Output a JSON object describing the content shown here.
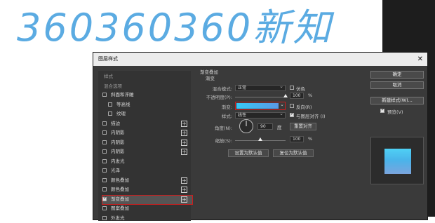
{
  "watermark": {
    "text": "360360360新知",
    "color": "#4aa3df"
  },
  "dialog": {
    "title": "图层样式",
    "close_glyph": "✕"
  },
  "left_panel": {
    "heading": "样式",
    "blend_options": "混合选项",
    "items": [
      {
        "label": "斜面和浮雕",
        "checked": false,
        "indent": false,
        "plus": false
      },
      {
        "label": "等高线",
        "checked": false,
        "indent": true,
        "plus": false
      },
      {
        "label": "纹理",
        "checked": false,
        "indent": true,
        "plus": false
      },
      {
        "label": "描边",
        "checked": false,
        "indent": false,
        "plus": true
      },
      {
        "label": "内阴影",
        "checked": false,
        "indent": false,
        "plus": true
      },
      {
        "label": "内阴影",
        "checked": false,
        "indent": false,
        "plus": true
      },
      {
        "label": "内阴影",
        "checked": false,
        "indent": false,
        "plus": true
      },
      {
        "label": "内发光",
        "checked": false,
        "indent": false,
        "plus": false
      },
      {
        "label": "光泽",
        "checked": false,
        "indent": false,
        "plus": false
      },
      {
        "label": "颜色叠加",
        "checked": false,
        "indent": false,
        "plus": true
      },
      {
        "label": "颜色叠加",
        "checked": false,
        "indent": false,
        "plus": true
      },
      {
        "label": "渐变叠加",
        "checked": true,
        "indent": false,
        "plus": true,
        "selected": true
      },
      {
        "label": "图案叠加",
        "checked": false,
        "indent": false,
        "plus": false
      },
      {
        "label": "外发光",
        "checked": false,
        "indent": false,
        "plus": false
      }
    ],
    "plus_glyph": "+"
  },
  "gradient_overlay": {
    "section_title": "渐变叠加",
    "subsection_title": "渐变",
    "blend_mode_label": "混合模式:",
    "blend_mode_value": "正常",
    "dither_label": "仿色",
    "opacity_label": "不透明度(P):",
    "opacity_value": "100",
    "opacity_fraction": 1.0,
    "percent": "%",
    "gradient_label": "渐变:",
    "reverse_label": "反向(R)",
    "style_label": "样式:",
    "style_value": "线性",
    "align_label": "与图层对齐 (I)",
    "angle_label": "角度(N):",
    "angle_value": "90",
    "degree_label": "度",
    "reset_align_button": "重置对齐",
    "scale_label": "缩放(S):",
    "scale_value": "100",
    "scale_fraction": 0.5,
    "set_default_button": "设置为默认值",
    "reset_default_button": "复位为默认值",
    "gradient_colors": [
      "#37c8f5",
      "#5a98e6"
    ],
    "dither_checked": false,
    "reverse_checked": false,
    "align_checked": true
  },
  "right_panel": {
    "ok_button": "确定",
    "cancel_button": "取消",
    "new_style_button": "新建样式(W)...",
    "preview_label": "预览(V)",
    "preview_checked": true
  },
  "colors": {
    "highlight": "#cc1e1e",
    "dialog_bg": "#3a3a3a"
  }
}
